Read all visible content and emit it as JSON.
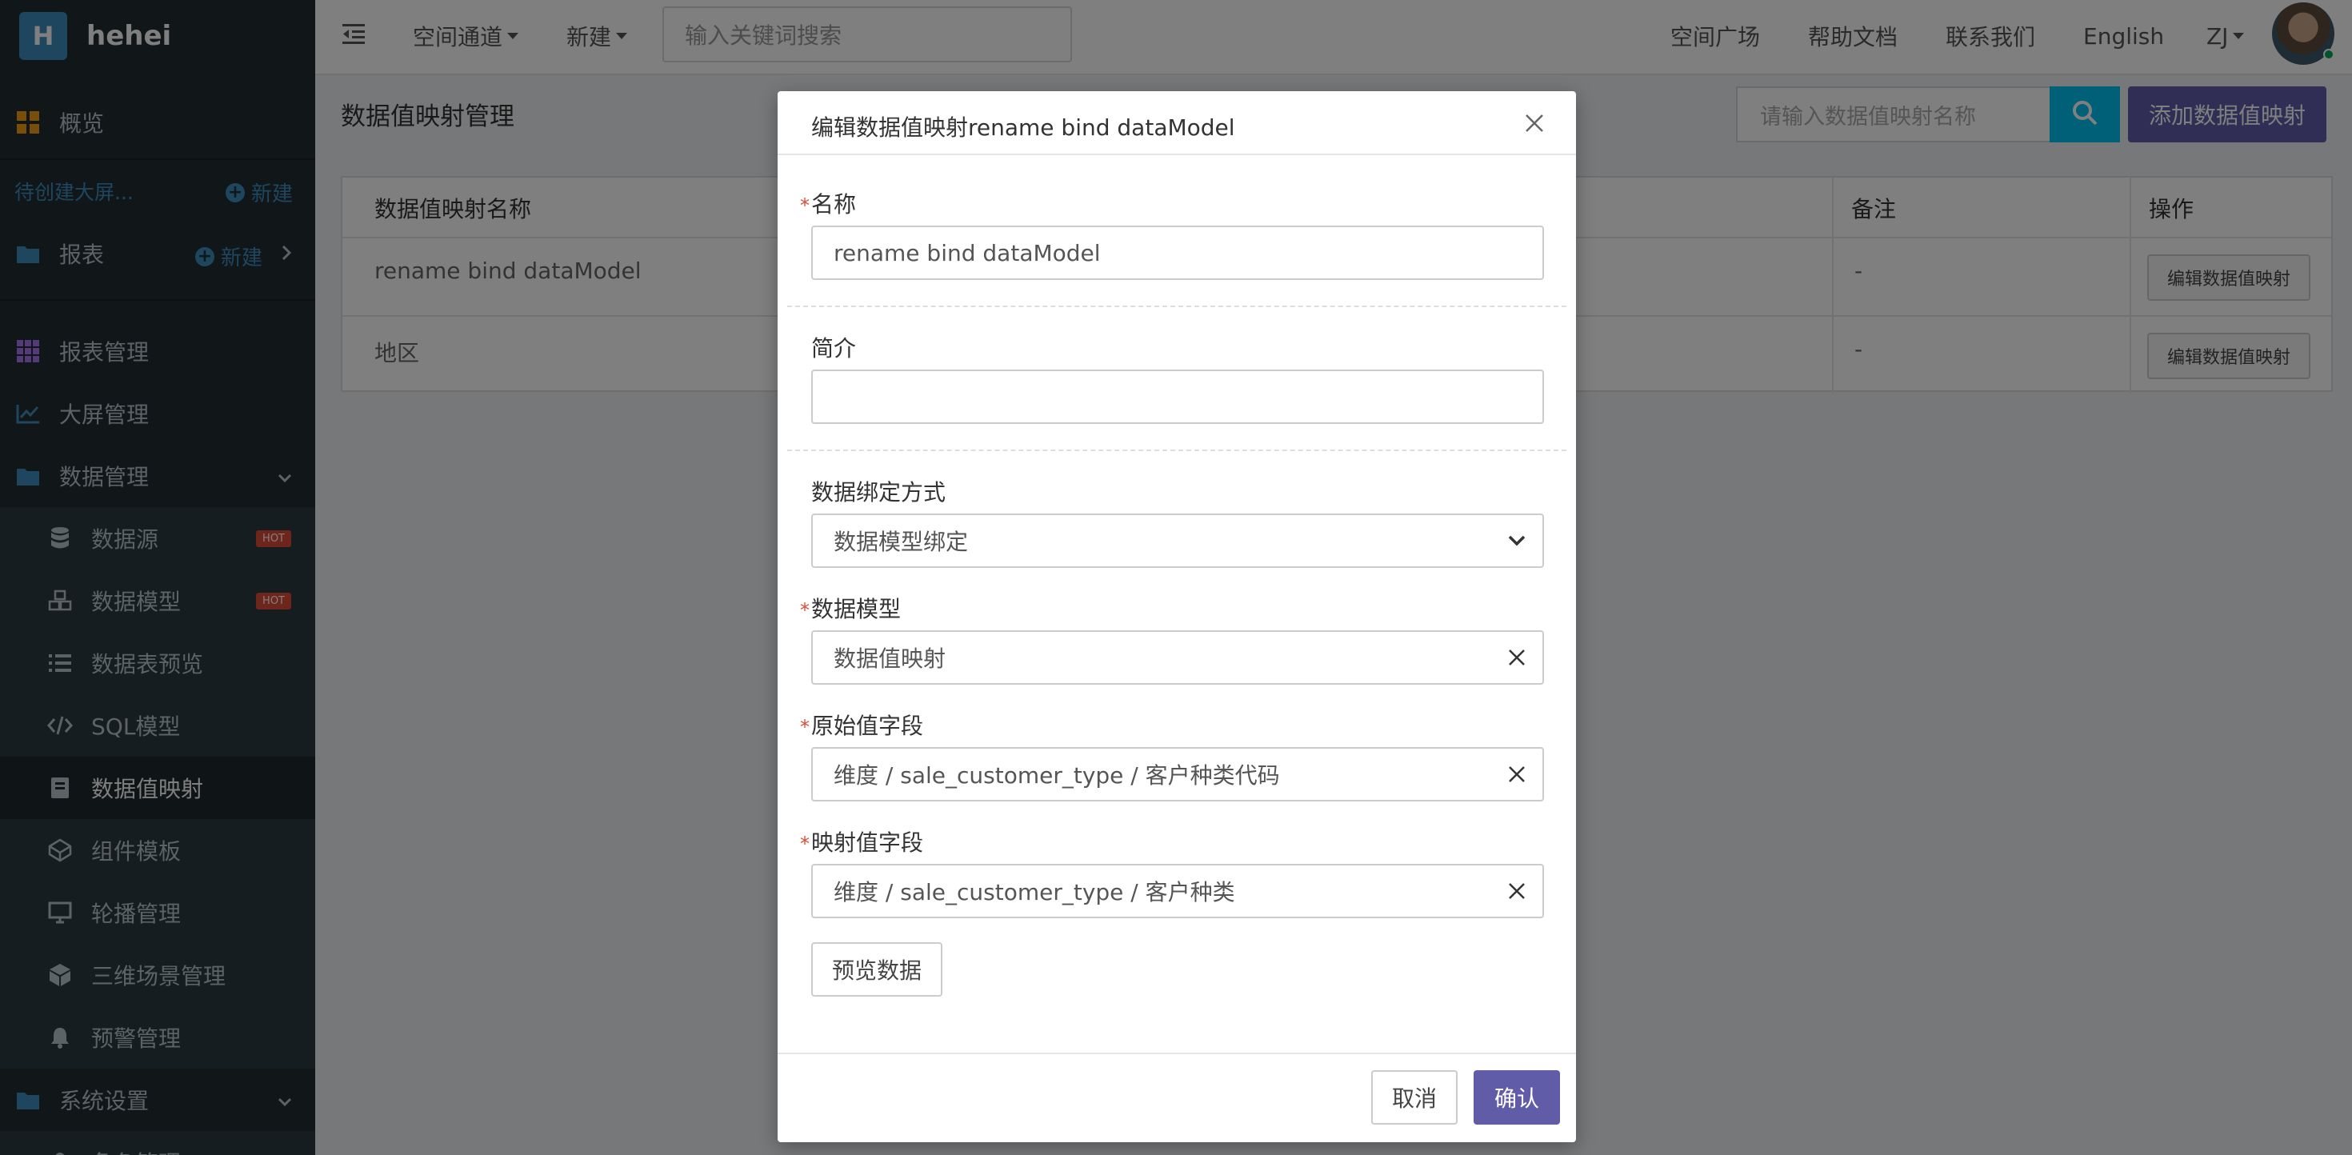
{
  "brand": {
    "logo_letter": "H",
    "name": "hehei"
  },
  "sidebar": {
    "overview": "概览",
    "pending_bigscreen": "待创建大屏...",
    "new_label": "新建",
    "reports": "报表",
    "report_mgmt": "报表管理",
    "bigscreen_mgmt": "大屏管理",
    "data_mgmt": "数据管理",
    "datasource": "数据源",
    "datamodel": "数据模型",
    "hot": "HOT",
    "table_preview": "数据表预览",
    "sql_model": "SQL模型",
    "value_mapping": "数据值映射",
    "component_template": "组件模板",
    "carousel_mgmt": "轮播管理",
    "scene3d_mgmt": "三维场景管理",
    "alert_mgmt": "预警管理",
    "system_settings": "系统设置",
    "partial_item": "角色管理"
  },
  "topbar": {
    "space_channel": "空间通道",
    "new": "新建",
    "search_placeholder": "输入关键词搜索",
    "space_square": "空间广场",
    "help_docs": "帮助文档",
    "contact_us": "联系我们",
    "language": "English",
    "user": "ZJ"
  },
  "page": {
    "title": "数据值映射管理",
    "search_placeholder": "请输入数据值映射名称",
    "add_button": "添加数据值映射",
    "columns": [
      "数据值映射名称",
      "备注",
      "操作"
    ],
    "rows": [
      {
        "name": "rename bind dataModel",
        "remark": "-",
        "action": "编辑数据值映射"
      },
      {
        "name": "地区",
        "remark": "-",
        "action": "编辑数据值映射"
      }
    ]
  },
  "modal": {
    "title": "编辑数据值映射rename bind dataModel",
    "required_mark": "*",
    "name_label": "名称",
    "name_value": "rename bind dataModel",
    "desc_label": "简介",
    "desc_value": "",
    "bind_label": "数据绑定方式",
    "bind_value": "数据模型绑定",
    "model_label": "数据模型",
    "model_value": "数据值映射",
    "source_field_label": "原始值字段",
    "source_field_value": "维度 / sale_customer_type / 客户种类代码",
    "mapped_field_label": "映射值字段",
    "mapped_field_value": "维度 / sale_customer_type / 客户种类",
    "preview_button": "预览数据",
    "cancel_button": "取消",
    "confirm_button": "确认"
  },
  "colors": {
    "sidebar": "#222d32",
    "accent": "#605ca8",
    "info": "#00c0ef",
    "link": "#3c8dbc",
    "danger": "#dd4b39"
  }
}
